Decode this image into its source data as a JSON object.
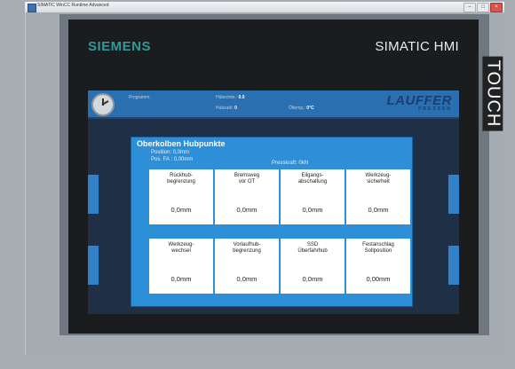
{
  "window": {
    "title": "SIMATIC WinCC Runtime Advanced",
    "min": "–",
    "max": "□",
    "close": "×"
  },
  "device": {
    "brand": "SIEMENS",
    "model": "SIMATIC HMI",
    "touch_label": "TOUCH"
  },
  "topbar": {
    "program_label": "Programm:",
    "hub_label": "Hübe/min.:",
    "hub_value": "0.0",
    "counter_label": "Hubzahl:",
    "counter_value": "0",
    "oil_label": "Öltemp.:",
    "oil_value": "0°C",
    "logo": "LAUFFER",
    "logo_sub": "PRESSEN"
  },
  "dialog": {
    "title": "Oberkolben Hubpunkte",
    "position_label": "Position:",
    "position_value": "0,0mm",
    "pos_fa_label": "Pos. FA :",
    "pos_fa_value": "0,00mm",
    "presskraft_label": "Presskraft:",
    "presskraft_value": "0kN",
    "row1": [
      {
        "label": "Rückhub-\nbegrenzung",
        "value": "0,0mm"
      },
      {
        "label": "Bremsweg\nvor OT",
        "value": "0,0mm"
      },
      {
        "label": "Eilgangs-\nabschaltung",
        "value": "0,0mm"
      },
      {
        "label": "Werkzeug-\nsicherheit",
        "value": "0,0mm"
      }
    ],
    "row2": [
      {
        "label": "Werkzeug-\nwechsel",
        "value": "0,0mm"
      },
      {
        "label": "Vorlaufhub-\nbegrenzung",
        "value": "0,0mm"
      },
      {
        "label": "SSD\nÜberfahrhub",
        "value": "0,0mm"
      },
      {
        "label": "Festanschlag\nSollposition",
        "value": "0,00mm"
      }
    ]
  }
}
